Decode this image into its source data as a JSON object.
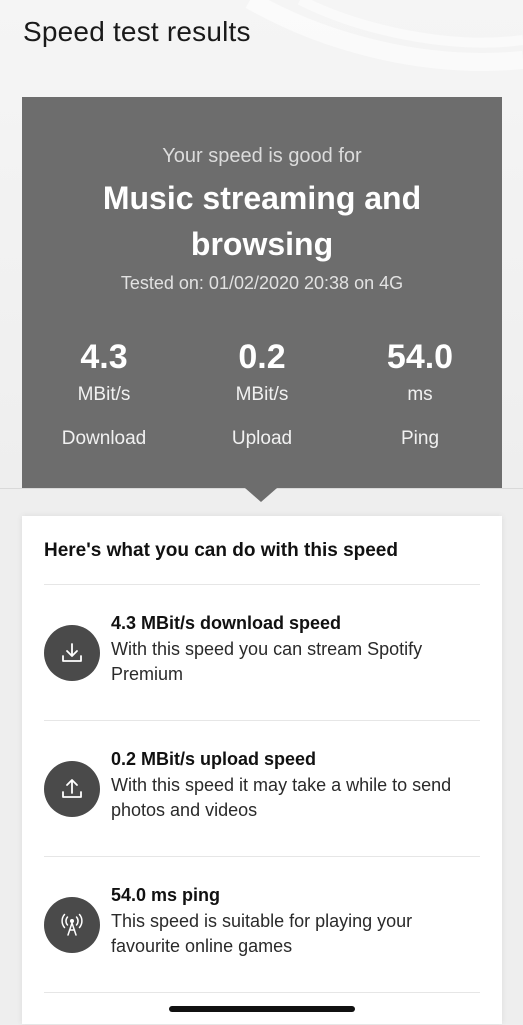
{
  "page": {
    "title": "Speed test results"
  },
  "summary": {
    "subtitle": "Your speed is good for",
    "headline": "Music streaming and browsing",
    "tested_on": "Tested on: 01/02/2020 20:38 on 4G",
    "metrics": [
      {
        "value": "4.3",
        "unit": "MBit/s",
        "label": "Download"
      },
      {
        "value": "0.2",
        "unit": "MBit/s",
        "label": "Upload"
      },
      {
        "value": "54.0",
        "unit": "ms",
        "label": "Ping"
      }
    ]
  },
  "details": {
    "heading": "Here's what you can do with this speed",
    "items": [
      {
        "icon": "download-icon",
        "title": "4.3 MBit/s download speed",
        "description": "With this speed you can stream Spotify Premium"
      },
      {
        "icon": "upload-icon",
        "title": "0.2 MBit/s upload speed",
        "description": "With this speed it may take a while to send photos and videos"
      },
      {
        "icon": "antenna-icon",
        "title": "54.0 ms ping",
        "description": "This speed is suitable for playing your favourite online games"
      }
    ]
  },
  "colors": {
    "panel": "#6d6d6d",
    "icon_circle": "#4a4a4a",
    "background": "#efefef"
  }
}
